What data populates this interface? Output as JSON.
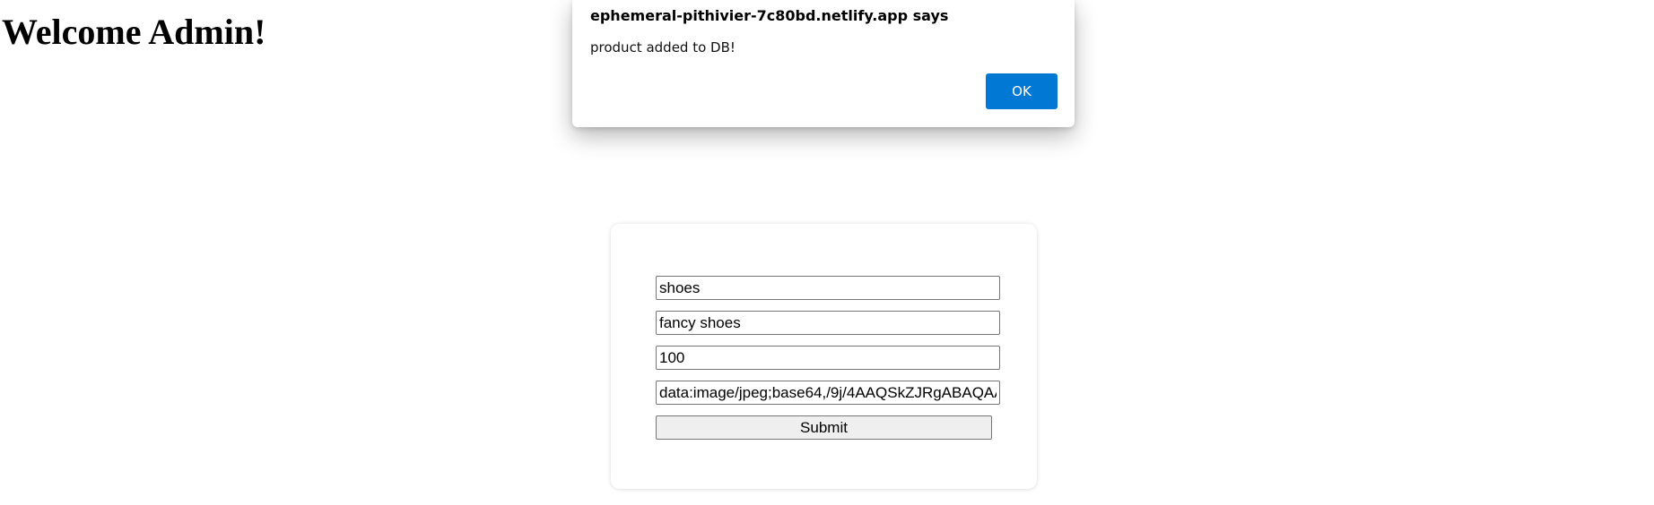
{
  "page": {
    "heading": "Welcome Admin!"
  },
  "form": {
    "fields": [
      {
        "value": "shoes"
      },
      {
        "value": "fancy shoes"
      },
      {
        "value": "100"
      },
      {
        "value": "data:image/jpeg;base64,/9j/4AAQSkZJRgABAQAA"
      }
    ],
    "submit_label": "Submit"
  },
  "dialog": {
    "title": "ephemeral-pithivier-7c80bd.netlify.app says",
    "message": "product added to DB!",
    "ok_label": "OK",
    "ok_color": "#0078d4"
  }
}
